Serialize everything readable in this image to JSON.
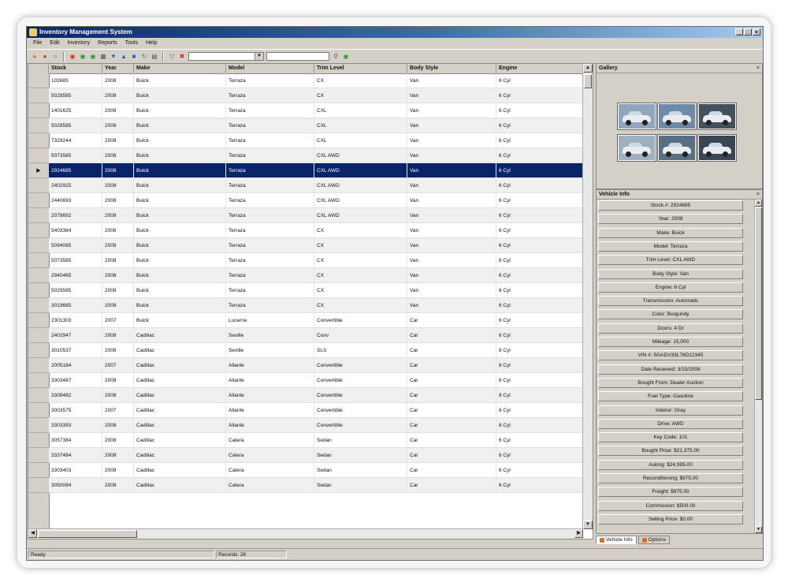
{
  "window": {
    "title": "Inventory Management System"
  },
  "menu": [
    "File",
    "Edit",
    "Inventory",
    "Reports",
    "Tools",
    "Help"
  ],
  "toolbar": {
    "combo_value": "",
    "textbox_value": ""
  },
  "grid": {
    "columns": [
      "Stock",
      "Year",
      "Make",
      "Model",
      "Trim Level",
      "Body Style",
      "Engine"
    ],
    "selected_row": 6,
    "rows": [
      [
        "102685",
        "2008",
        "Buick",
        "Terraza",
        "CX",
        "Van",
        "6 Cyl"
      ],
      [
        "5029585",
        "2008",
        "Buick",
        "Terraza",
        "CX",
        "Van",
        "6 Cyl"
      ],
      [
        "1401625",
        "2008",
        "Buick",
        "Terraza",
        "CXL",
        "Van",
        "6 Cyl"
      ],
      [
        "5028585",
        "2008",
        "Buick",
        "Terraza",
        "CXL",
        "Van",
        "6 Cyl"
      ],
      [
        "7329244",
        "2008",
        "Buick",
        "Terraza",
        "CXL",
        "Van",
        "6 Cyl"
      ],
      [
        "5073585",
        "2008",
        "Buick",
        "Terraza",
        "CXL AWD",
        "Van",
        "6 Cyl"
      ],
      [
        "2924685",
        "2008",
        "Buick",
        "Terraza",
        "CXL AWD",
        "Van",
        "6 Cyl"
      ],
      [
        "2402925",
        "2008",
        "Buick",
        "Terraza",
        "CXL AWD",
        "Van",
        "6 Cyl"
      ],
      [
        "2440693",
        "2008",
        "Buick",
        "Terraza",
        "CXL AWD",
        "Van",
        "6 Cyl"
      ],
      [
        "2078692",
        "2008",
        "Buick",
        "Terraza",
        "CXL AWD",
        "Van",
        "6 Cyl"
      ],
      [
        "5403384",
        "2008",
        "Buick",
        "Terraza",
        "CX",
        "Van",
        "6 Cyl"
      ],
      [
        "5094065",
        "2008",
        "Buick",
        "Terraza",
        "CX",
        "Van",
        "6 Cyl"
      ],
      [
        "5073585",
        "2008",
        "Buick",
        "Terraza",
        "CX",
        "Van",
        "6 Cyl"
      ],
      [
        "2940465",
        "2008",
        "Buick",
        "Terraza",
        "CX",
        "Van",
        "6 Cyl"
      ],
      [
        "5029585",
        "2008",
        "Buick",
        "Terraza",
        "CX",
        "Van",
        "6 Cyl"
      ],
      [
        "3019685",
        "2008",
        "Buick",
        "Terraza",
        "CX",
        "Van",
        "6 Cyl"
      ],
      [
        "2301303",
        "2007",
        "Buick",
        "Lucerne",
        "Convertible",
        "Car",
        "6 Cyl"
      ],
      [
        "2402947",
        "2008",
        "Cadillac",
        "Seville",
        "Conv",
        "Car",
        "6 Cyl"
      ],
      [
        "3010537",
        "2008",
        "Cadillac",
        "Seville",
        "SLS",
        "Car",
        "8 Cyl"
      ],
      [
        "2005184",
        "2007",
        "Cadillac",
        "Allante",
        "Convertible",
        "Car",
        "8 Cyl"
      ],
      [
        "3303487",
        "2008",
        "Cadillac",
        "Allante",
        "Convertible",
        "Car",
        "6 Cyl"
      ],
      [
        "3309482",
        "2008",
        "Cadillac",
        "Allante",
        "Convertible",
        "Car",
        "8 Cyl"
      ],
      [
        "3003575",
        "2007",
        "Cadillac",
        "Allante",
        "Convertible",
        "Car",
        "6 Cyl"
      ],
      [
        "3303393",
        "2008",
        "Cadillac",
        "Allante",
        "Convertible",
        "Car",
        "8 Cyl"
      ],
      [
        "3057384",
        "2008",
        "Cadillac",
        "Catera",
        "Sedan",
        "Car",
        "6 Cyl"
      ],
      [
        "3337484",
        "2008",
        "Cadillac",
        "Catera",
        "Sedan",
        "Car",
        "6 Cyl"
      ],
      [
        "3303403",
        "2008",
        "Cadillac",
        "Catera",
        "Sedan",
        "Car",
        "6 Cyl"
      ],
      [
        "3050094",
        "2008",
        "Cadillac",
        "Catera",
        "Sedan",
        "Car",
        "6 Cyl"
      ]
    ]
  },
  "gallery": {
    "title": "Gallery",
    "buttons": "×",
    "photo_count": 6
  },
  "vehicle_info": {
    "title": "Vehicle Info",
    "buttons": "×",
    "fields": [
      "Stock #: 2924685",
      "Year: 2008",
      "Make: Buick",
      "Model: Terraza",
      "Trim Level: CXL AWD",
      "Body Style: Van",
      "Engine: 6 Cyl",
      "Transmission: Automatic",
      "Color: Burgundy",
      "Doors: 4 Dr",
      "Mileage: 15,000",
      "VIN #: 5GADV33L76D12345",
      "Date Received: 3/15/2008",
      "Bought From: Dealer Auction",
      "Fuel Type: Gasoline",
      "Interior: Gray",
      "Drive: AWD",
      "Key Code: 101",
      "Bought Price: $21,375.00",
      "Asking: $24,995.00",
      "Reconditioning: $975.00",
      "Freight: $975.00",
      "Commission: $500.00",
      "Selling Price: $0.00"
    ]
  },
  "tabs": [
    "Vehicle Info",
    "Options"
  ],
  "status": {
    "left": "Ready",
    "right": "Records: 28"
  },
  "colors": {
    "title_start": "#0a246a",
    "selected_row": "#0a246a",
    "window_bg": "#d4d0c8"
  }
}
